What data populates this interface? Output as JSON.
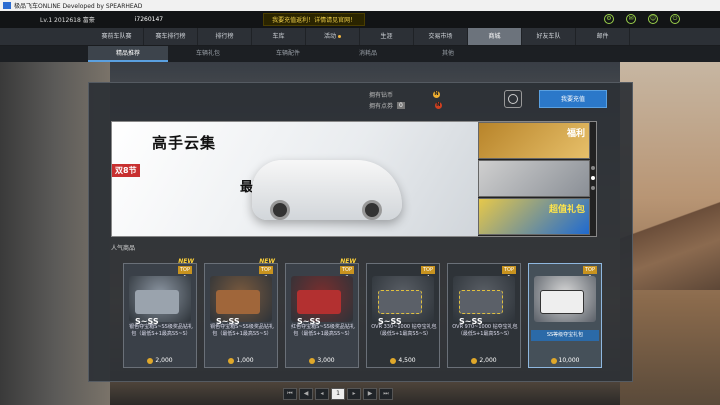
{
  "titlebar": {
    "title": "极品飞车ONLINE   Developed by SPEARHEAD"
  },
  "status": {
    "level": "Lv.1  2012618  富豪",
    "name": "i7260147",
    "notice": "我要充值返利！详情请见官网！"
  },
  "nav": {
    "tabs": [
      {
        "label": "赛前车队赛"
      },
      {
        "label": "赛车排行榜"
      },
      {
        "label": "排行榜"
      },
      {
        "label": "车库"
      },
      {
        "label": "活动"
      },
      {
        "label": "生涯"
      },
      {
        "label": "交易市场"
      },
      {
        "label": "商城"
      },
      {
        "label": "好友车队"
      },
      {
        "label": "邮件"
      }
    ]
  },
  "subnav": {
    "tabs": [
      {
        "label": "精品推荐"
      },
      {
        "label": "车辆礼包"
      },
      {
        "label": "车辆配件"
      },
      {
        "label": "消耗品"
      },
      {
        "label": "其他"
      }
    ]
  },
  "controls": {
    "diamond_label": "拥有钻币",
    "point_label": "拥有点券",
    "point_value": "0",
    "recharge": "我要充值"
  },
  "banner": {
    "title": "高手云集",
    "sub_a": "双8节",
    "sub_b": "最强夺宝",
    "thumb1": "福利",
    "thumb3": "超值礼包"
  },
  "section": {
    "label": "人气商品"
  },
  "items": [
    {
      "new": "NEW",
      "top": "TOP 1",
      "grade": "S~SS",
      "desc": "银色夺宝箱S~SS级奖品钻礼包（最低S+1最高S5~S）",
      "price": "2,000",
      "color": "#9aa3ad"
    },
    {
      "new": "NEW",
      "top": "TOP 2",
      "grade": "S~SS",
      "desc": "铜色夺宝箱S~SS级奖品钻礼包（最低S+1最高S5~S）",
      "price": "1,000",
      "color": "#a0663a"
    },
    {
      "new": "NEW",
      "top": "TOP 3",
      "grade": "S~SS",
      "desc": "红色夺宝箱S~SS级奖品钻礼包（最低S+1最高S5~S）",
      "price": "3,000",
      "color": "#b33030"
    },
    {
      "top": "TOP 4",
      "grade": "S~SS",
      "desc": "OVR 330~1000 钻夺宝礼包（最低S+1最高S5~S）",
      "price": "4,500",
      "color": "#5b6068"
    },
    {
      "top": "TOP 5",
      "grade": "S~SS",
      "desc": "OVR 970~1000 钻夺宝礼包（最低S+1最高S5~S）",
      "price": "2,000",
      "color": "#5b6068"
    },
    {
      "top": "TOP 6",
      "grade": "",
      "desc": "",
      "selected_label": "SS等级夺宝礼包",
      "price": "10,000",
      "color": "#4a4f56"
    }
  ],
  "overlay": {
    "label": "SS等级夺宝礼包"
  },
  "pager": {
    "current": "1"
  }
}
